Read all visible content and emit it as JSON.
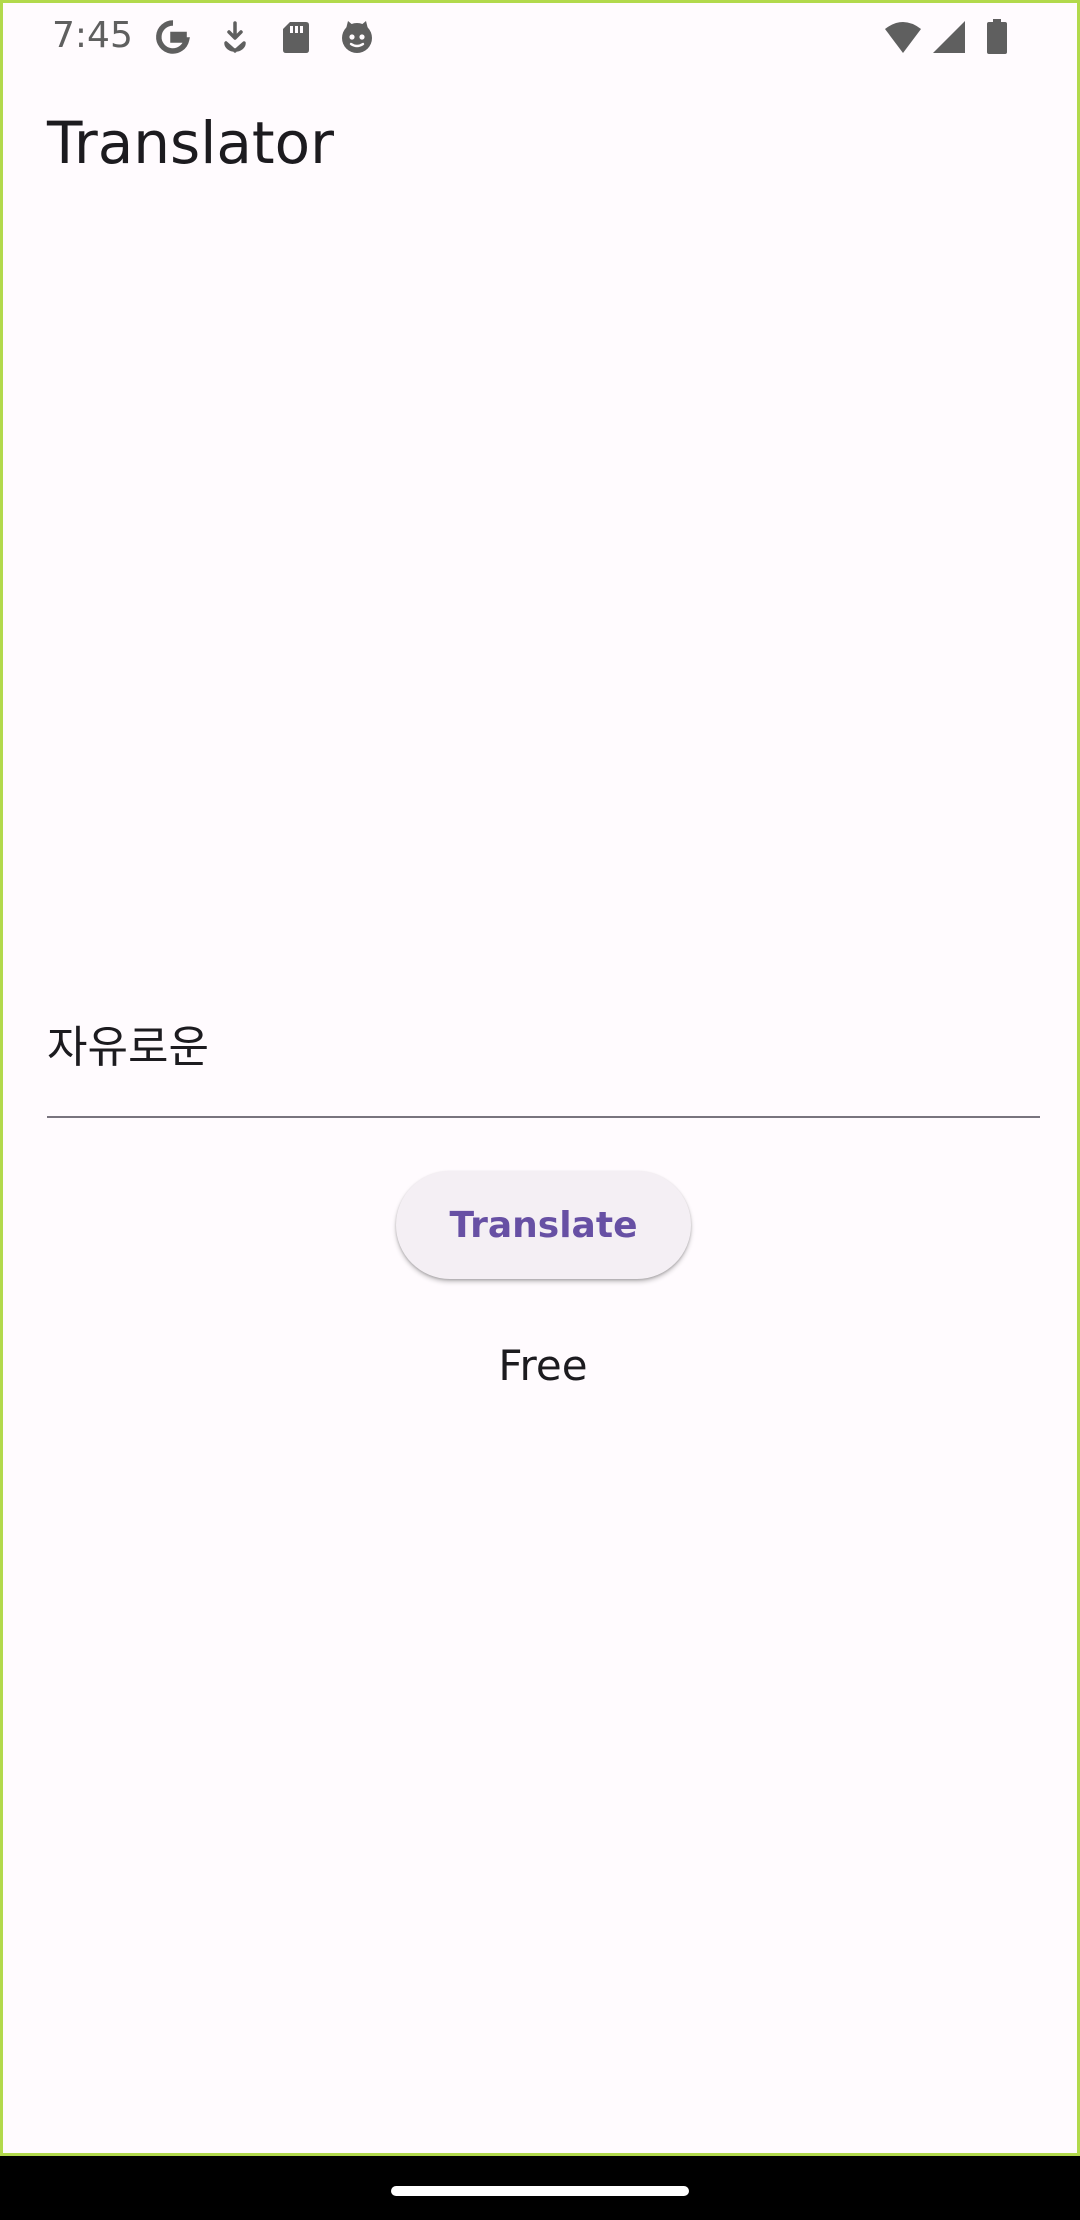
{
  "status_bar": {
    "time": "7:45",
    "left_icons": [
      "google-g-icon",
      "download-icon",
      "sd-card-icon",
      "cat-face-icon"
    ],
    "right_icons": [
      "wifi-icon",
      "cell-signal-icon",
      "battery-icon"
    ],
    "icon_color": "#5f5f5f"
  },
  "app_bar": {
    "title": "Translator"
  },
  "input": {
    "value": "자유로운"
  },
  "actions": {
    "translate_label": "Translate"
  },
  "result": {
    "text": "Free"
  },
  "colors": {
    "background": "#fffbfe",
    "accent": "#6750a4",
    "button_surface": "#f4eff4",
    "frame_border": "#b2d94c"
  }
}
